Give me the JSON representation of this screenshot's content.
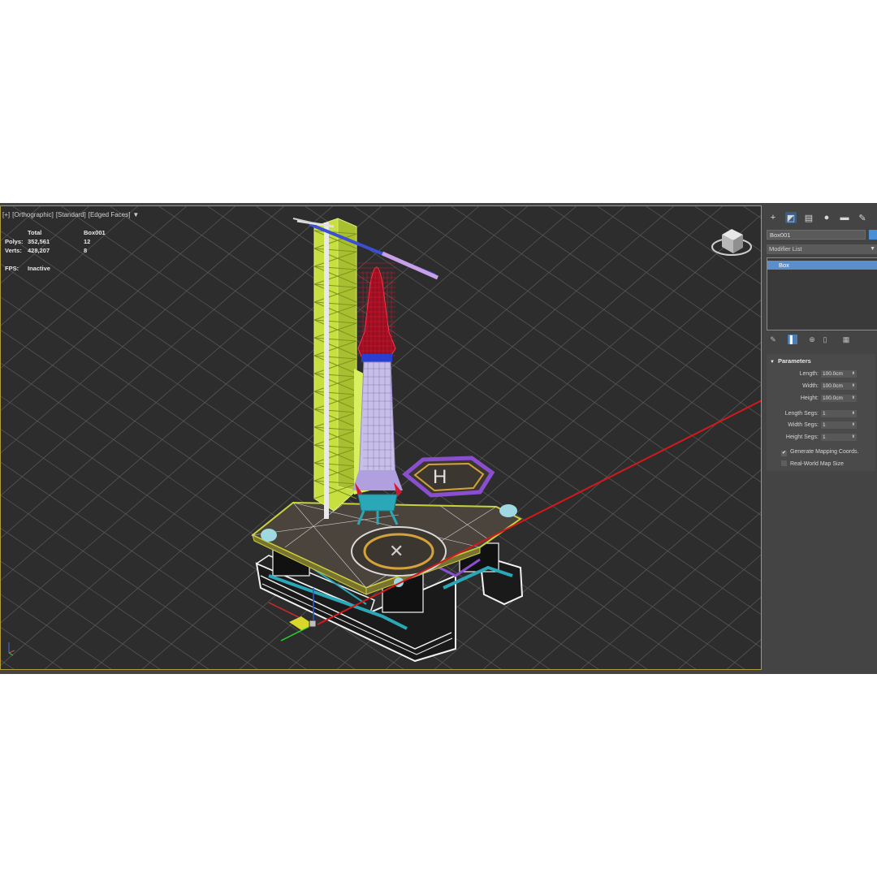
{
  "viewport": {
    "labels": [
      "[+]",
      "[Orthographic]",
      "[Standard]",
      "[Edged Faces]"
    ],
    "filter_icon": "funnel-icon",
    "stats": {
      "header_total": "Total",
      "header_object": "Box001",
      "polys_label": "Polys:",
      "polys_total": "352,561",
      "polys_object": "12",
      "verts_label": "Verts:",
      "verts_total": "428,207",
      "verts_object": "8",
      "fps_label": "FPS:",
      "fps_value": "Inactive"
    },
    "grid_color": "#6a6a6a",
    "frame_color": "#b39a3a"
  },
  "command_panel": {
    "tabs": [
      "create-icon",
      "modify-icon",
      "hierarchy-icon",
      "motion-icon",
      "display-icon",
      "utilities-icon"
    ],
    "active_tab": "modify-icon",
    "object_name": "Box001",
    "object_color": "#4a90d9",
    "modifier_list_label": "Modifier List",
    "stack_items": [
      "Box"
    ],
    "stack_tools": [
      "pin-stack-icon",
      "show-end-result-icon",
      "make-unique-icon",
      "remove-modifier-icon",
      "configure-sets-icon"
    ],
    "rollout": {
      "title": "Parameters",
      "length_label": "Length:",
      "length_value": "100.0cm",
      "width_label": "Width:",
      "width_value": "100.0cm",
      "height_label": "Height:",
      "height_value": "100.0cm",
      "length_segs_label": "Length Segs:",
      "length_segs_value": "1",
      "width_segs_label": "Width Segs:",
      "width_segs_value": "1",
      "height_segs_label": "Height Segs:",
      "height_segs_value": "1",
      "gen_mapping_label": "Generate Mapping Coords.",
      "gen_mapping_checked": true,
      "real_world_label": "Real-World Map Size",
      "real_world_checked": false
    }
  }
}
